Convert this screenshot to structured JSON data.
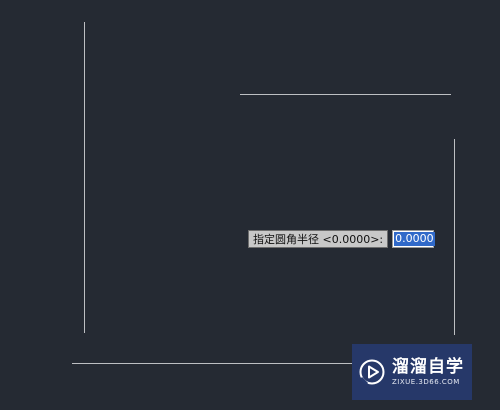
{
  "command_prompt": {
    "label": "指定圆角半径 <0.0000>:",
    "input_value": "0.0000"
  },
  "watermark": {
    "name": "溜溜自学",
    "url": "ZIXUE.3D66.COM"
  },
  "colors": {
    "background": "#252a33",
    "line": "#bdbfc3",
    "selection": "#3069c9",
    "watermark_bg": "#263a6e"
  },
  "icons": {
    "watermark_logo": "play-circle-icon"
  }
}
